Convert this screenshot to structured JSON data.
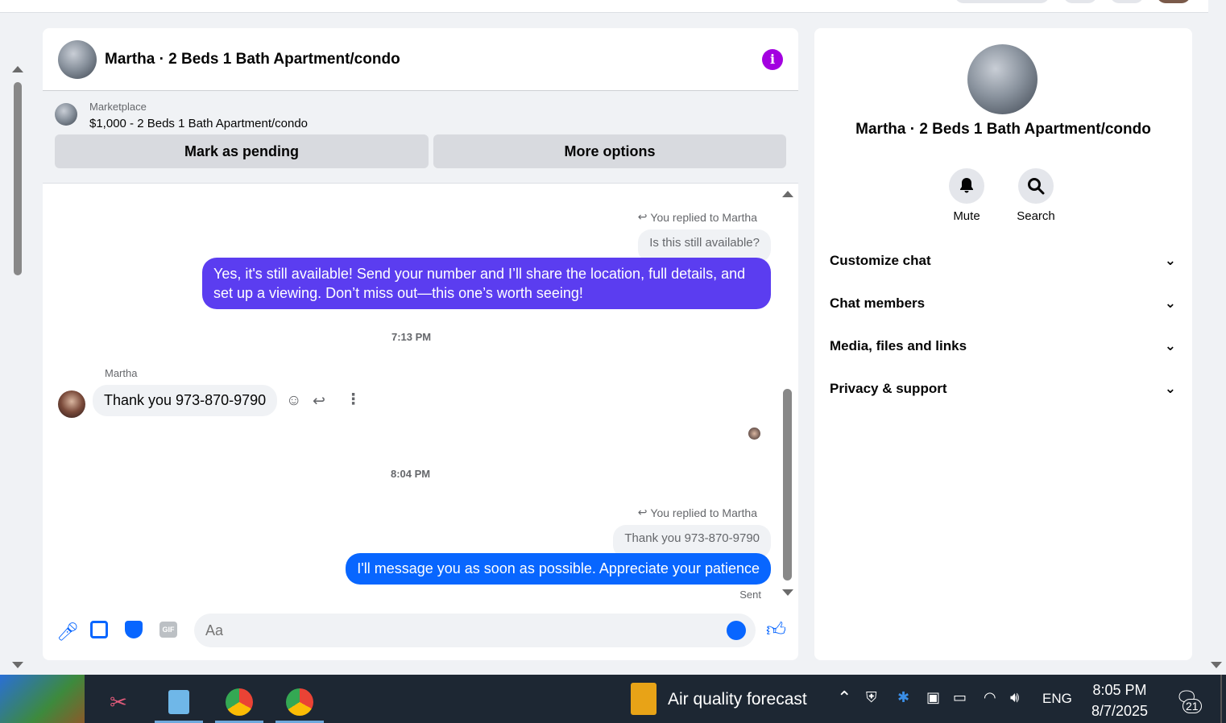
{
  "header": {
    "title": "Martha · 2 Beds 1 Bath Apartment/condo"
  },
  "marketplace": {
    "source": "Marketplace",
    "listing": "$1,000 - 2 Beds 1 Bath Apartment/condo",
    "mark_pending_label": "Mark as pending",
    "more_options_label": "More options"
  },
  "messages": {
    "reply1_label": "You replied to Martha",
    "reply1_quote": "Is this still available?",
    "reply1_text": "Yes, it's still available! Send your number and I’ll share the location, full details, and set up a viewing. Don’t miss out—this one’s worth seeing!",
    "time1": "7:13 PM",
    "incoming_sender": "Martha",
    "incoming_text": "Thank you 973-870-9790",
    "time2": "8:04 PM",
    "reply2_label": "You replied to Martha",
    "reply2_quote": "Thank you 973-870-9790",
    "reply2_text": "I'll message you as soon as possible. Appreciate your patience",
    "status": "Sent"
  },
  "composer": {
    "placeholder": "Aa"
  },
  "sidebar": {
    "title": "Martha · 2 Beds 1 Bath Apartment/condo",
    "mute_label": "Mute",
    "search_label": "Search",
    "sections": [
      "Customize chat",
      "Chat members",
      "Media, files and links",
      "Privacy & support"
    ]
  },
  "taskbar": {
    "weather": "Air quality forecast",
    "language": "ENG",
    "time": "8:05 PM",
    "date": "8/7/2025",
    "notifications": "21"
  },
  "colors": {
    "accent_purple": "#5b3df0",
    "accent_blue": "#0866ff",
    "info_purple": "#a300e0"
  }
}
